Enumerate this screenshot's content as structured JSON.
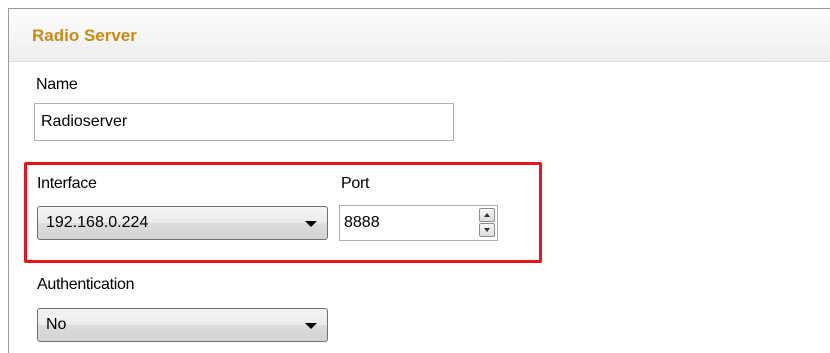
{
  "header": {
    "title": "Radio Server"
  },
  "name_field": {
    "label": "Name",
    "value": "Radioserver"
  },
  "interface_field": {
    "label": "Interface",
    "selected": "192.168.0.224"
  },
  "port_field": {
    "label": "Port",
    "value": "8888"
  },
  "authentication_field": {
    "label": "Authentication",
    "selected": "No"
  },
  "colors": {
    "header_title": "#c98a17",
    "highlight_border": "#e8141b",
    "panel_border": "#9a9a9a"
  },
  "icons": {
    "dropdown": "chevron-down-icon",
    "spin_up": "spin-up-icon",
    "spin_down": "spin-down-icon"
  }
}
